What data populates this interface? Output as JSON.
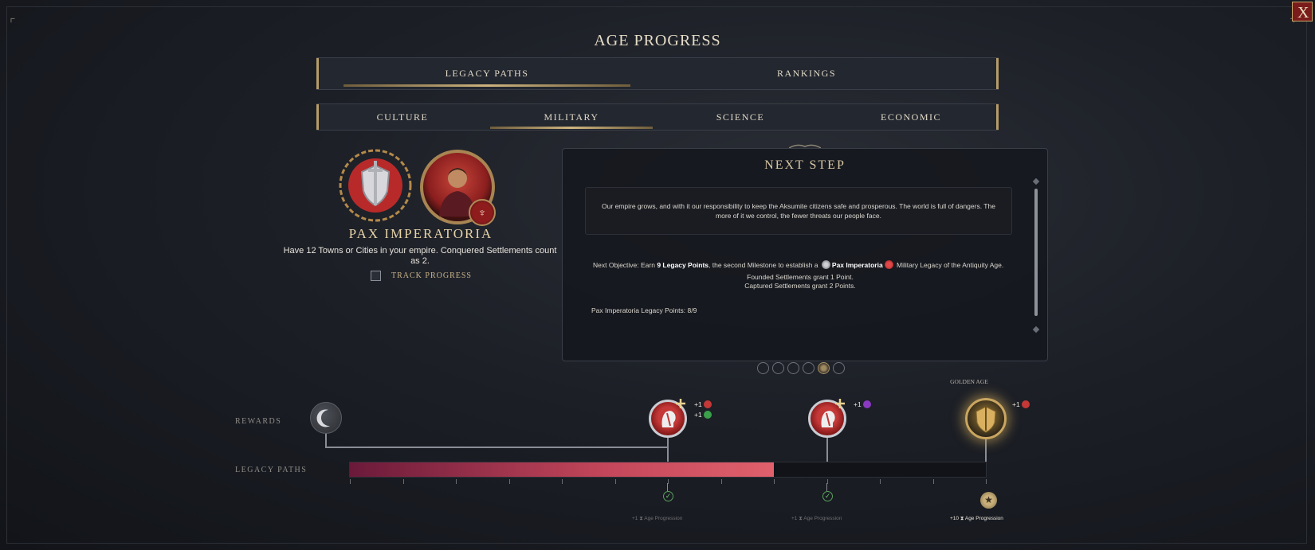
{
  "window": {
    "title": "AGE PROGRESS",
    "close_label": "X"
  },
  "top_tabs": [
    {
      "label": "LEGACY PATHS",
      "active": true
    },
    {
      "label": "RANKINGS",
      "active": false
    }
  ],
  "sub_tabs": [
    {
      "label": "CULTURE",
      "active": false
    },
    {
      "label": "MILITARY",
      "active": true
    },
    {
      "label": "SCIENCE",
      "active": false
    },
    {
      "label": "ECONOMIC",
      "active": false
    }
  ],
  "legacy_path": {
    "name": "PAX IMPERATORIA",
    "description": "Have 12 Towns or Cities in your empire. Conquered Settlements count as 2.",
    "track_progress_label": "TRACK PROGRESS",
    "track_progress_checked": false
  },
  "next_step": {
    "title": "NEXT STEP",
    "flavor_text": "Our empire grows, and with it our responsibility to keep the Aksumite citizens safe and prosperous. The world is full of dangers. The more of it we control, the fewer threats our people face.",
    "objective_prefix": "Next Objective: Earn ",
    "objective_points": "9 Legacy Points",
    "objective_mid": ", the second Milestone to establish a ",
    "objective_legacy": "Pax Imperatoria",
    "objective_suffix": " Military Legacy of the Antiquity Age.",
    "rule_founded": "Founded Settlements grant 1 Point.",
    "rule_captured": "Captured Settlements grant 2 Points.",
    "points_status": "Pax Imperatoria Legacy Points: 8/9",
    "page_count": 6,
    "active_page": 5
  },
  "progress": {
    "rewards_label": "REWARDS",
    "legacy_paths_label": "LEGACY PATHS",
    "golden_age_label": "GOLDEN AGE",
    "current_points": 8,
    "max_points": 12,
    "milestones": [
      {
        "points": 6,
        "bonuses": [
          "+1",
          "+1"
        ],
        "age_progression": "+1",
        "age_progression_label": "Age Progression",
        "completed": true
      },
      {
        "points": 9,
        "bonuses": [
          "+1"
        ],
        "age_progression": "+1",
        "age_progression_label": "Age Progression",
        "completed": false
      },
      {
        "points": 12,
        "bonuses": [
          "+1"
        ],
        "age_progression": "+10",
        "age_progression_label": "Age Progression",
        "completed": false
      }
    ]
  },
  "colors": {
    "accent_gold": "#cdb37e",
    "bar_fill_start": "#6b1a3a",
    "bar_fill_end": "#e0606c",
    "military_red": "#c43838"
  },
  "icons": [
    "shield-laurel-icon",
    "leader-portrait-icon",
    "crescent-moon-icon",
    "military-head-icon",
    "golden-shield-icon",
    "check-icon",
    "star-icon"
  ]
}
